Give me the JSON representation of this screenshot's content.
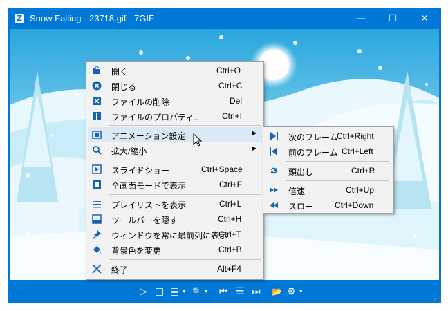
{
  "window": {
    "title": "Snow Falling - 23718.gif - 7GIF",
    "app_icon": "Z",
    "controls": {
      "minimize": "—",
      "maximize": "☐",
      "close": "✕"
    }
  },
  "context_menu": {
    "items": [
      {
        "label": "開く",
        "shortcut": "Ctrl+O",
        "icon": "open-icon"
      },
      {
        "label": "閉じる",
        "shortcut": "Ctrl+C",
        "icon": "close-file-icon"
      },
      {
        "label": "ファイルの削除",
        "shortcut": "Del",
        "icon": "delete-icon"
      },
      {
        "label": "ファイルのプロパティ..",
        "shortcut": "Ctrl+I",
        "icon": "info-icon"
      },
      {
        "label": "アニメーション設定",
        "shortcut": "",
        "icon": "animation-icon",
        "submenu": true
      },
      {
        "label": "拡大/縮小",
        "shortcut": "",
        "icon": "zoom-icon",
        "submenu": true
      },
      {
        "label": "スライドショー",
        "shortcut": "Ctrl+Space",
        "icon": "slideshow-icon"
      },
      {
        "label": "全画面モードで表示",
        "shortcut": "Ctrl+F",
        "icon": "fullscreen-icon"
      },
      {
        "label": "プレイリストを表示",
        "shortcut": "Ctrl+L",
        "icon": "playlist-icon"
      },
      {
        "label": "ツールバーを隠す",
        "shortcut": "Ctrl+H",
        "icon": "toolbar-icon"
      },
      {
        "label": "ウィンドウを常に最前列に表示",
        "shortcut": "Ctrl+T",
        "icon": "pin-icon"
      },
      {
        "label": "背景色を変更",
        "shortcut": "Ctrl+B",
        "icon": "paint-bucket-icon"
      },
      {
        "label": "終了",
        "shortcut": "Alt+F4",
        "icon": "exit-icon"
      }
    ]
  },
  "submenu": {
    "items": [
      {
        "label": "次のフレーム",
        "shortcut": "Ctrl+Right",
        "icon": "next-frame-icon"
      },
      {
        "label": "前のフレーム",
        "shortcut": "Ctrl+Left",
        "icon": "prev-frame-icon"
      },
      {
        "label": "頭出し",
        "shortcut": "Ctrl+R",
        "icon": "rewind-icon"
      },
      {
        "label": "倍速",
        "shortcut": "Ctrl+Up",
        "icon": "fast-forward-icon"
      },
      {
        "label": "スロー",
        "shortcut": "Ctrl+Down",
        "icon": "slow-icon"
      }
    ]
  },
  "toolbar": {
    "glyphs": {
      "play": "▷",
      "stop": "□",
      "frames": "▤",
      "zoom": "🔍",
      "dropdown": "▾",
      "prev": "⏮",
      "playlist": "☰",
      "next": "⏭",
      "open": "📂",
      "settings": "⚙"
    }
  },
  "colors": {
    "accent": "#0078d7",
    "menu_bg": "#f2f2f2",
    "highlight": "#dbe8f6",
    "icon_blue": "#1463b5"
  }
}
